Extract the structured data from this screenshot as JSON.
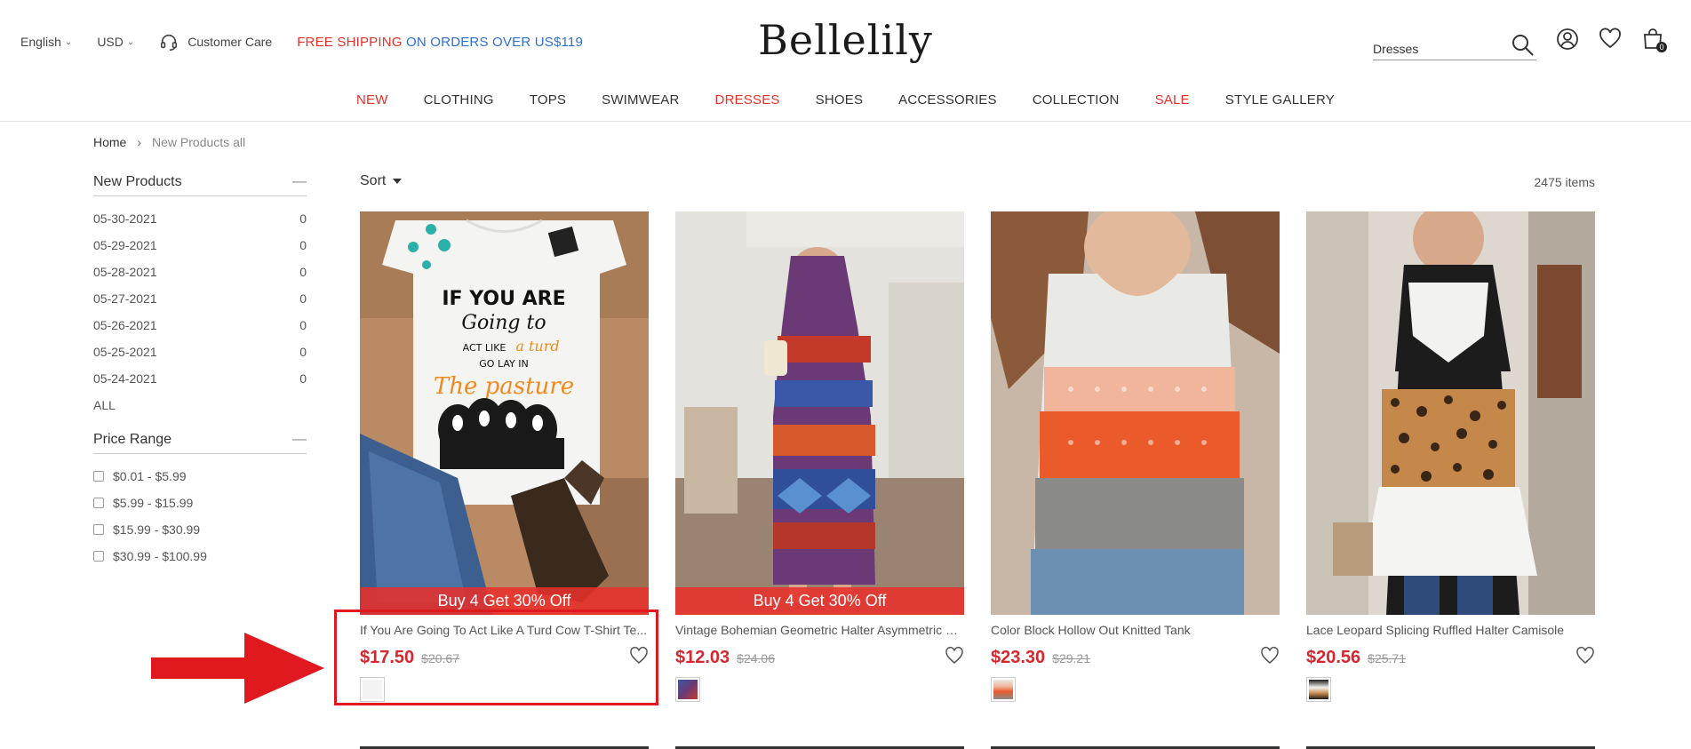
{
  "header": {
    "language": "English",
    "currency": "USD",
    "customer_care": "Customer Care",
    "promo_red": "FREE SHIPPING",
    "promo_blue": "ON ORDERS OVER US$119",
    "logo": "Bellelily",
    "search_value": "Dresses",
    "cart_count": "0"
  },
  "nav": [
    {
      "label": "NEW",
      "accent": true
    },
    {
      "label": "CLOTHING",
      "accent": false
    },
    {
      "label": "TOPS",
      "accent": false
    },
    {
      "label": "SWIMWEAR",
      "accent": false
    },
    {
      "label": "DRESSES",
      "accent": true
    },
    {
      "label": "SHOES",
      "accent": false
    },
    {
      "label": "ACCESSORIES",
      "accent": false
    },
    {
      "label": "COLLECTION",
      "accent": false
    },
    {
      "label": "SALE",
      "accent": true
    },
    {
      "label": "STYLE GALLERY",
      "accent": false
    }
  ],
  "breadcrumb": {
    "home": "Home",
    "current": "New Products all"
  },
  "sidebar": {
    "new_products_title": "New Products",
    "dates": [
      {
        "date": "05-30-2021",
        "count": "0"
      },
      {
        "date": "05-29-2021",
        "count": "0"
      },
      {
        "date": "05-28-2021",
        "count": "0"
      },
      {
        "date": "05-27-2021",
        "count": "0"
      },
      {
        "date": "05-26-2021",
        "count": "0"
      },
      {
        "date": "05-25-2021",
        "count": "0"
      },
      {
        "date": "05-24-2021",
        "count": "0"
      }
    ],
    "all_label": "ALL",
    "price_title": "Price Range",
    "prices": [
      "$0.01 - $5.99",
      "$5.99 - $15.99",
      "$15.99 - $30.99",
      "$30.99 - $100.99"
    ]
  },
  "listing": {
    "sort_label": "Sort",
    "item_count": "2475 items"
  },
  "products": [
    {
      "title": "If You Are Going To Act Like A Turd Cow T-Shirt Te...",
      "price": "$17.50",
      "old_price": "$20.67",
      "promo": "Buy 4 Get 30% Off",
      "image": "cow-print-tshirt-with-boots",
      "swatch_color": "#f3f3f3",
      "shirt_text": [
        "IF YOU ARE",
        "Going to",
        "ACT LIKE",
        "a turd",
        "GO LAY IN",
        "The pasture"
      ]
    },
    {
      "title": "Vintage Bohemian Geometric Halter Asymmetric M...",
      "price": "$12.03",
      "old_price": "$24.06",
      "promo": "Buy 4 Get 30% Off",
      "image": "bohemian-maxi-dress",
      "swatch_color": "#5a3a52"
    },
    {
      "title": "Color Block Hollow Out Knitted Tank",
      "price": "$23.30",
      "old_price": "$29.21",
      "promo": "",
      "image": "color-block-knit-tank",
      "swatch_color": "#e87a4a"
    },
    {
      "title": "Lace Leopard Splicing Ruffled Halter Camisole",
      "price": "$20.56",
      "old_price": "$25.71",
      "promo": "",
      "image": "lace-leopard-camisole",
      "swatch_color": "#2a2a2a"
    }
  ],
  "colors": {
    "accent_red": "#e8302b",
    "price_red": "#d7262e",
    "promo_blue": "#2e6fd6"
  }
}
